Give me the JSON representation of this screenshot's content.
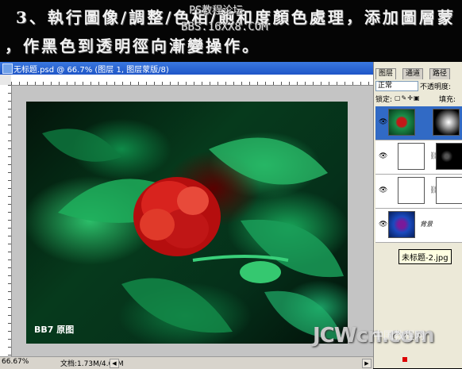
{
  "caption": {
    "line1": "3、執行圖像/調整/色相/飽和度顏色處理，添加圖層蒙",
    "line2": "，作黑色到透明徑向漸變操作。",
    "watermark_top": "PS教程论坛",
    "watermark_url": "BBS.16XX8.COM"
  },
  "document": {
    "title": "无标题.psd @ 66.7% (图层 1, 图层蒙版/8)",
    "photo_label": "BB7 原图",
    "zoom": "66.67%",
    "doc_size": "文档:1.73M/4.63M"
  },
  "panel": {
    "tabs": [
      "图层",
      "通道",
      "路径"
    ],
    "blend_mode": "正常",
    "opacity_label": "不透明度:",
    "lock_label": "锁定:",
    "fill_label": "填充:",
    "background_layer_name": "背景",
    "tooltip": "未标题-2.jpg"
  },
  "branding": {
    "site_cn": "中国教程网",
    "site_en": "JCWcn.com"
  },
  "colors": {
    "titlebar": "#1f56c8",
    "selected_layer": "#316ac5"
  }
}
